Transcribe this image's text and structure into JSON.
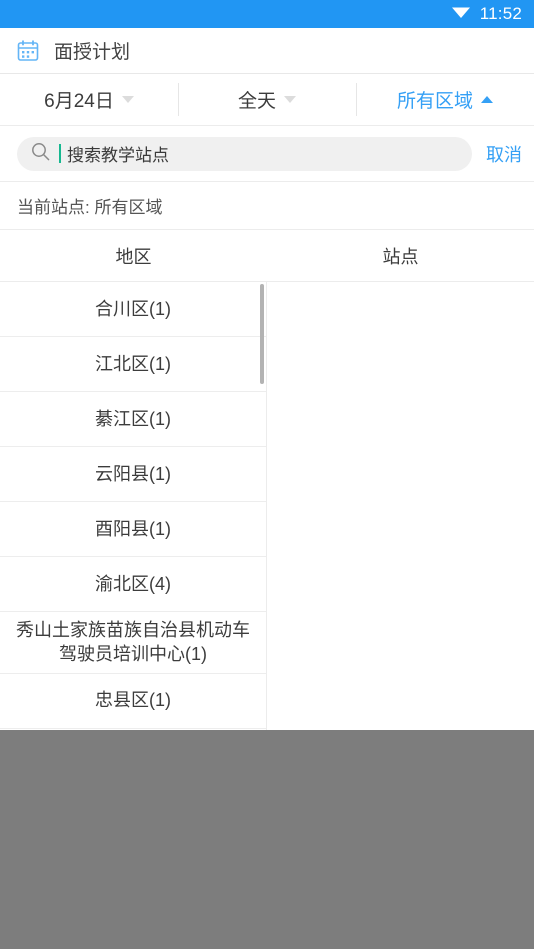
{
  "status_bar": {
    "time": "11:52",
    "wifi_icon": "wifi-icon",
    "background": "#2196f3"
  },
  "app_bar": {
    "icon": "calendar-icon",
    "title": "面授计划"
  },
  "filters": [
    {
      "label": "6月24日",
      "caret": "chevron-down-icon",
      "active": false
    },
    {
      "label": "全天",
      "caret": "chevron-down-icon",
      "active": false
    },
    {
      "label": "所有区域",
      "caret": "chevron-up-icon",
      "active": true
    }
  ],
  "search": {
    "icon": "search-icon",
    "value": "",
    "placeholder": "搜索教学站点",
    "cancel_label": "取消",
    "caret_color": "#17b890"
  },
  "current_station": {
    "text": "当前站点: 所有区域"
  },
  "columns": {
    "left_header": "地区",
    "right_header": "站点"
  },
  "regions": [
    {
      "label": "合川区(1)"
    },
    {
      "label": "江北区(1)"
    },
    {
      "label": "綦江区(1)"
    },
    {
      "label": "云阳县(1)"
    },
    {
      "label": "酉阳县(1)"
    },
    {
      "label": "渝北区(4)"
    },
    {
      "label": "秀山土家族苗族自治县机动车驾驶员培训中心(1)"
    },
    {
      "label": "忠县区(1)"
    }
  ],
  "stations": [],
  "colors": {
    "accent": "#35a0f5",
    "status_bar": "#2196f3",
    "dim_overlay": "#7d7d7d",
    "divider": "#ececec"
  }
}
